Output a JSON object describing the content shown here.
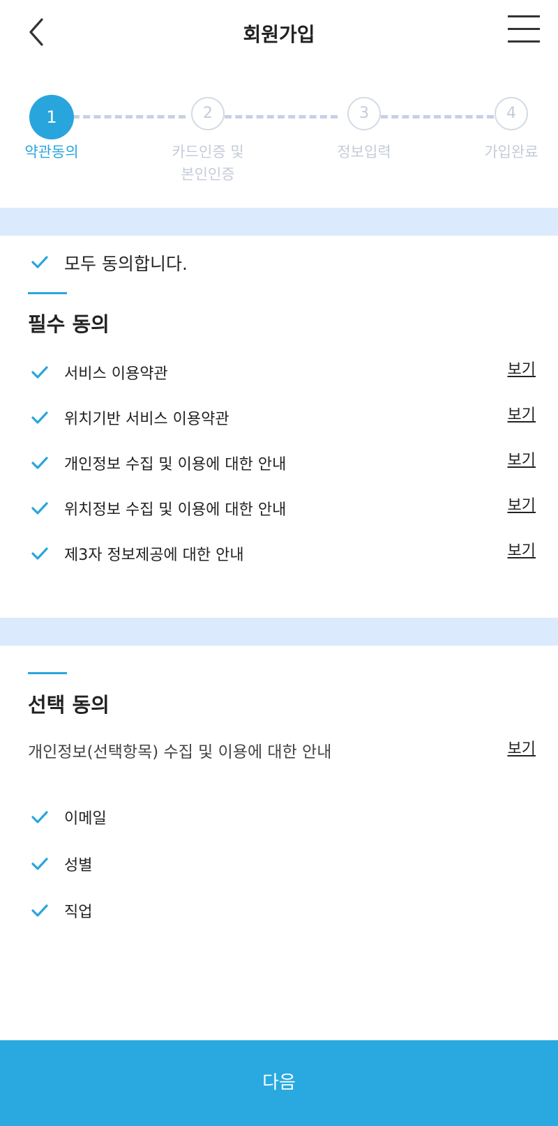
{
  "header": {
    "title": "회원가입",
    "back_icon": "chevron-left-icon",
    "menu_icon": "hamburger-menu-icon"
  },
  "steps": [
    {
      "number": "1",
      "label": "약관동의",
      "active": true
    },
    {
      "number": "2",
      "label": "카드인증 및\n본인인증",
      "active": false
    },
    {
      "number": "3",
      "label": "정보입력",
      "active": false
    },
    {
      "number": "4",
      "label": "가입완료",
      "active": false
    }
  ],
  "agree_all": {
    "label": "모두 동의합니다.",
    "checked": true
  },
  "required": {
    "title": "필수 동의",
    "items": [
      {
        "label": "서비스 이용약관",
        "link": "보기",
        "checked": true
      },
      {
        "label": "위치기반 서비스 이용약관",
        "link": "보기",
        "checked": true
      },
      {
        "label": "개인정보 수집 및 이용에 대한 안내",
        "link": "보기",
        "checked": true
      },
      {
        "label": "위치정보 수집 및 이용에 대한 안내",
        "link": "보기",
        "checked": true
      },
      {
        "label": "제3자 정보제공에 대한 안내",
        "link": "보기",
        "checked": true
      }
    ]
  },
  "optional": {
    "title": "선택 동의",
    "notice": {
      "label": "개인정보(선택항목) 수집 및 이용에 대한 안내",
      "link": "보기"
    },
    "items": [
      {
        "label": "이메일",
        "checked": true
      },
      {
        "label": "성별",
        "checked": true
      },
      {
        "label": "직업",
        "checked": true
      }
    ]
  },
  "footer": {
    "next_label": "다음"
  },
  "colors": {
    "accent": "#29a5dd",
    "band": "#dbeafd",
    "inactive_step": "#c4cbd8",
    "check": "#29a5dd"
  }
}
